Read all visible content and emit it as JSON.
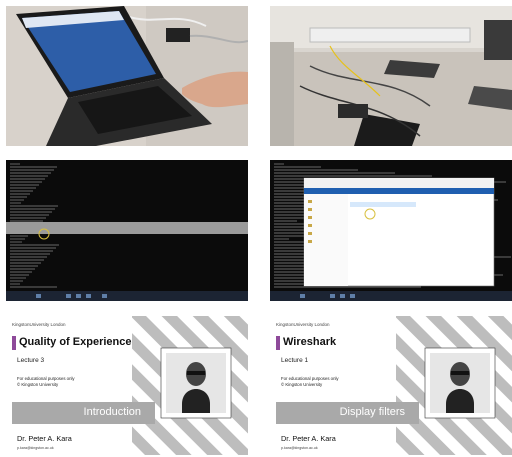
{
  "tiles": [
    {
      "kind": "photo",
      "subject": "laptop-on-desk"
    },
    {
      "kind": "photo",
      "subject": "lab-cabling"
    },
    {
      "kind": "screenshot",
      "subject": "terminal-window"
    },
    {
      "kind": "screenshot",
      "subject": "file-explorer-over-terminal"
    }
  ],
  "slides": [
    {
      "university": "KingstonUniversity London",
      "title": "Quality of Experience",
      "lecture": "Lecture 3",
      "note1": "For educational purposes only",
      "note2": "© Kingston University",
      "topic": "Introduction",
      "author": "Dr. Peter A. Kara",
      "email": "p.kara@kingston.ac.uk"
    },
    {
      "university": "KingstonUniversity London",
      "title": "Wireshark",
      "lecture": "Lecture 1",
      "note1": "For educational purposes only",
      "note2": "© Kingston University",
      "topic": "Display filters",
      "author": "Dr. Peter A. Kara",
      "email": "p.kara@kingston.ac.uk"
    }
  ],
  "colors": {
    "accent_bar": "#8e4a9a",
    "topic_band": "#a9a9a9",
    "pattern": "#bdbdbd",
    "terminal_bg": "#0b0b0b",
    "taskbar": "#1c2433"
  }
}
